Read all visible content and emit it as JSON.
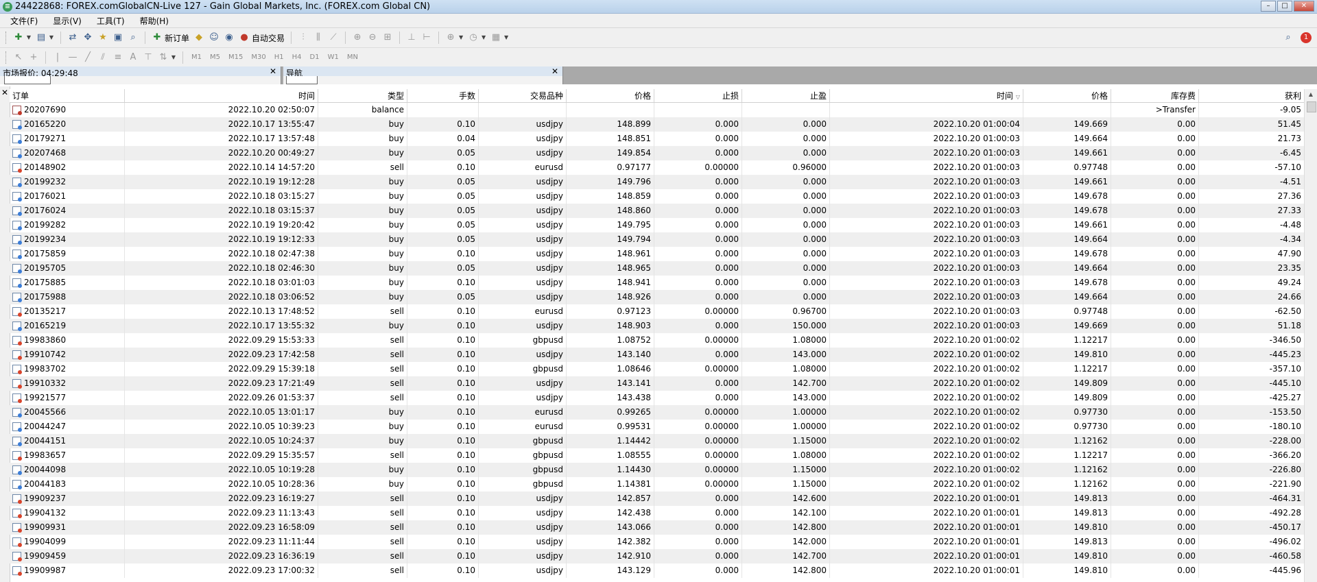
{
  "window": {
    "title": "24422868: FOREX.comGlobalCN-Live 127 - Gain Global Markets, Inc. (FOREX.com Global CN)",
    "app_icon": "mt4-app-icon"
  },
  "menu": [
    "文件(F)",
    "显示(V)",
    "工具(T)",
    "帮助(H)"
  ],
  "toolbar": {
    "new_order_label": "新订单",
    "auto_trade_label": "自动交易",
    "timeframes": [
      "M1",
      "M5",
      "M15",
      "M30",
      "H1",
      "H4",
      "D1",
      "W1",
      "MN"
    ],
    "notification_count": "1"
  },
  "panels": {
    "market_watch_title": "市场报价: 04:29:48",
    "navigator_title": "导航"
  },
  "columns": {
    "order": "订单",
    "open_time": "时间",
    "type": "类型",
    "lots": "手数",
    "symbol": "交易品种",
    "open_price": "价格",
    "sl": "止损",
    "tp": "止盈",
    "close_time": "时间",
    "close_price": "价格",
    "swap": "库存费",
    "profit": "获利"
  },
  "colors": {
    "buy_dot": "#3b7dd8",
    "sell_dot": "#d9442b",
    "balance_dot": "#c0392b"
  },
  "rows": [
    {
      "order": "20207690",
      "open_time": "2022.10.20 02:50:07",
      "type": "balance",
      "lots": "",
      "symbol": "",
      "open_price": "",
      "sl": "",
      "tp": "",
      "close_time": "",
      "close_price": "",
      "swap": ">Transfer",
      "profit": "-9.05"
    },
    {
      "order": "20165220",
      "open_time": "2022.10.17 13:55:47",
      "type": "buy",
      "lots": "0.10",
      "symbol": "usdjpy",
      "open_price": "148.899",
      "sl": "0.000",
      "tp": "0.000",
      "close_time": "2022.10.20 01:00:04",
      "close_price": "149.669",
      "swap": "0.00",
      "profit": "51.45"
    },
    {
      "order": "20179271",
      "open_time": "2022.10.17 13:57:48",
      "type": "buy",
      "lots": "0.04",
      "symbol": "usdjpy",
      "open_price": "148.851",
      "sl": "0.000",
      "tp": "0.000",
      "close_time": "2022.10.20 01:00:03",
      "close_price": "149.664",
      "swap": "0.00",
      "profit": "21.73"
    },
    {
      "order": "20207468",
      "open_time": "2022.10.20 00:49:27",
      "type": "buy",
      "lots": "0.05",
      "symbol": "usdjpy",
      "open_price": "149.854",
      "sl": "0.000",
      "tp": "0.000",
      "close_time": "2022.10.20 01:00:03",
      "close_price": "149.661",
      "swap": "0.00",
      "profit": "-6.45"
    },
    {
      "order": "20148902",
      "open_time": "2022.10.14 14:57:20",
      "type": "sell",
      "lots": "0.10",
      "symbol": "eurusd",
      "open_price": "0.97177",
      "sl": "0.00000",
      "tp": "0.96000",
      "close_time": "2022.10.20 01:00:03",
      "close_price": "0.97748",
      "swap": "0.00",
      "profit": "-57.10"
    },
    {
      "order": "20199232",
      "open_time": "2022.10.19 19:12:28",
      "type": "buy",
      "lots": "0.05",
      "symbol": "usdjpy",
      "open_price": "149.796",
      "sl": "0.000",
      "tp": "0.000",
      "close_time": "2022.10.20 01:00:03",
      "close_price": "149.661",
      "swap": "0.00",
      "profit": "-4.51"
    },
    {
      "order": "20176021",
      "open_time": "2022.10.18 03:15:27",
      "type": "buy",
      "lots": "0.05",
      "symbol": "usdjpy",
      "open_price": "148.859",
      "sl": "0.000",
      "tp": "0.000",
      "close_time": "2022.10.20 01:00:03",
      "close_price": "149.678",
      "swap": "0.00",
      "profit": "27.36"
    },
    {
      "order": "20176024",
      "open_time": "2022.10.18 03:15:37",
      "type": "buy",
      "lots": "0.05",
      "symbol": "usdjpy",
      "open_price": "148.860",
      "sl": "0.000",
      "tp": "0.000",
      "close_time": "2022.10.20 01:00:03",
      "close_price": "149.678",
      "swap": "0.00",
      "profit": "27.33"
    },
    {
      "order": "20199282",
      "open_time": "2022.10.19 19:20:42",
      "type": "buy",
      "lots": "0.05",
      "symbol": "usdjpy",
      "open_price": "149.795",
      "sl": "0.000",
      "tp": "0.000",
      "close_time": "2022.10.20 01:00:03",
      "close_price": "149.661",
      "swap": "0.00",
      "profit": "-4.48"
    },
    {
      "order": "20199234",
      "open_time": "2022.10.19 19:12:33",
      "type": "buy",
      "lots": "0.05",
      "symbol": "usdjpy",
      "open_price": "149.794",
      "sl": "0.000",
      "tp": "0.000",
      "close_time": "2022.10.20 01:00:03",
      "close_price": "149.664",
      "swap": "0.00",
      "profit": "-4.34"
    },
    {
      "order": "20175859",
      "open_time": "2022.10.18 02:47:38",
      "type": "buy",
      "lots": "0.10",
      "symbol": "usdjpy",
      "open_price": "148.961",
      "sl": "0.000",
      "tp": "0.000",
      "close_time": "2022.10.20 01:00:03",
      "close_price": "149.678",
      "swap": "0.00",
      "profit": "47.90"
    },
    {
      "order": "20195705",
      "open_time": "2022.10.18 02:46:30",
      "type": "buy",
      "lots": "0.05",
      "symbol": "usdjpy",
      "open_price": "148.965",
      "sl": "0.000",
      "tp": "0.000",
      "close_time": "2022.10.20 01:00:03",
      "close_price": "149.664",
      "swap": "0.00",
      "profit": "23.35"
    },
    {
      "order": "20175885",
      "open_time": "2022.10.18 03:01:03",
      "type": "buy",
      "lots": "0.10",
      "symbol": "usdjpy",
      "open_price": "148.941",
      "sl": "0.000",
      "tp": "0.000",
      "close_time": "2022.10.20 01:00:03",
      "close_price": "149.678",
      "swap": "0.00",
      "profit": "49.24"
    },
    {
      "order": "20175988",
      "open_time": "2022.10.18 03:06:52",
      "type": "buy",
      "lots": "0.05",
      "symbol": "usdjpy",
      "open_price": "148.926",
      "sl": "0.000",
      "tp": "0.000",
      "close_time": "2022.10.20 01:00:03",
      "close_price": "149.664",
      "swap": "0.00",
      "profit": "24.66"
    },
    {
      "order": "20135217",
      "open_time": "2022.10.13 17:48:52",
      "type": "sell",
      "lots": "0.10",
      "symbol": "eurusd",
      "open_price": "0.97123",
      "sl": "0.00000",
      "tp": "0.96700",
      "close_time": "2022.10.20 01:00:03",
      "close_price": "0.97748",
      "swap": "0.00",
      "profit": "-62.50"
    },
    {
      "order": "20165219",
      "open_time": "2022.10.17 13:55:32",
      "type": "buy",
      "lots": "0.10",
      "symbol": "usdjpy",
      "open_price": "148.903",
      "sl": "0.000",
      "tp": "150.000",
      "close_time": "2022.10.20 01:00:03",
      "close_price": "149.669",
      "swap": "0.00",
      "profit": "51.18"
    },
    {
      "order": "19983860",
      "open_time": "2022.09.29 15:53:33",
      "type": "sell",
      "lots": "0.10",
      "symbol": "gbpusd",
      "open_price": "1.08752",
      "sl": "0.00000",
      "tp": "1.08000",
      "close_time": "2022.10.20 01:00:02",
      "close_price": "1.12217",
      "swap": "0.00",
      "profit": "-346.50"
    },
    {
      "order": "19910742",
      "open_time": "2022.09.23 17:42:58",
      "type": "sell",
      "lots": "0.10",
      "symbol": "usdjpy",
      "open_price": "143.140",
      "sl": "0.000",
      "tp": "143.000",
      "close_time": "2022.10.20 01:00:02",
      "close_price": "149.810",
      "swap": "0.00",
      "profit": "-445.23"
    },
    {
      "order": "19983702",
      "open_time": "2022.09.29 15:39:18",
      "type": "sell",
      "lots": "0.10",
      "symbol": "gbpusd",
      "open_price": "1.08646",
      "sl": "0.00000",
      "tp": "1.08000",
      "close_time": "2022.10.20 01:00:02",
      "close_price": "1.12217",
      "swap": "0.00",
      "profit": "-357.10"
    },
    {
      "order": "19910332",
      "open_time": "2022.09.23 17:21:49",
      "type": "sell",
      "lots": "0.10",
      "symbol": "usdjpy",
      "open_price": "143.141",
      "sl": "0.000",
      "tp": "142.700",
      "close_time": "2022.10.20 01:00:02",
      "close_price": "149.809",
      "swap": "0.00",
      "profit": "-445.10"
    },
    {
      "order": "19921577",
      "open_time": "2022.09.26 01:53:37",
      "type": "sell",
      "lots": "0.10",
      "symbol": "usdjpy",
      "open_price": "143.438",
      "sl": "0.000",
      "tp": "143.000",
      "close_time": "2022.10.20 01:00:02",
      "close_price": "149.809",
      "swap": "0.00",
      "profit": "-425.27"
    },
    {
      "order": "20045566",
      "open_time": "2022.10.05 13:01:17",
      "type": "buy",
      "lots": "0.10",
      "symbol": "eurusd",
      "open_price": "0.99265",
      "sl": "0.00000",
      "tp": "1.00000",
      "close_time": "2022.10.20 01:00:02",
      "close_price": "0.97730",
      "swap": "0.00",
      "profit": "-153.50"
    },
    {
      "order": "20044247",
      "open_time": "2022.10.05 10:39:23",
      "type": "buy",
      "lots": "0.10",
      "symbol": "eurusd",
      "open_price": "0.99531",
      "sl": "0.00000",
      "tp": "1.00000",
      "close_time": "2022.10.20 01:00:02",
      "close_price": "0.97730",
      "swap": "0.00",
      "profit": "-180.10"
    },
    {
      "order": "20044151",
      "open_time": "2022.10.05 10:24:37",
      "type": "buy",
      "lots": "0.10",
      "symbol": "gbpusd",
      "open_price": "1.14442",
      "sl": "0.00000",
      "tp": "1.15000",
      "close_time": "2022.10.20 01:00:02",
      "close_price": "1.12162",
      "swap": "0.00",
      "profit": "-228.00"
    },
    {
      "order": "19983657",
      "open_time": "2022.09.29 15:35:57",
      "type": "sell",
      "lots": "0.10",
      "symbol": "gbpusd",
      "open_price": "1.08555",
      "sl": "0.00000",
      "tp": "1.08000",
      "close_time": "2022.10.20 01:00:02",
      "close_price": "1.12217",
      "swap": "0.00",
      "profit": "-366.20"
    },
    {
      "order": "20044098",
      "open_time": "2022.10.05 10:19:28",
      "type": "buy",
      "lots": "0.10",
      "symbol": "gbpusd",
      "open_price": "1.14430",
      "sl": "0.00000",
      "tp": "1.15000",
      "close_time": "2022.10.20 01:00:02",
      "close_price": "1.12162",
      "swap": "0.00",
      "profit": "-226.80"
    },
    {
      "order": "20044183",
      "open_time": "2022.10.05 10:28:36",
      "type": "buy",
      "lots": "0.10",
      "symbol": "gbpusd",
      "open_price": "1.14381",
      "sl": "0.00000",
      "tp": "1.15000",
      "close_time": "2022.10.20 01:00:02",
      "close_price": "1.12162",
      "swap": "0.00",
      "profit": "-221.90"
    },
    {
      "order": "19909237",
      "open_time": "2022.09.23 16:19:27",
      "type": "sell",
      "lots": "0.10",
      "symbol": "usdjpy",
      "open_price": "142.857",
      "sl": "0.000",
      "tp": "142.600",
      "close_time": "2022.10.20 01:00:01",
      "close_price": "149.813",
      "swap": "0.00",
      "profit": "-464.31"
    },
    {
      "order": "19904132",
      "open_time": "2022.09.23 11:13:43",
      "type": "sell",
      "lots": "0.10",
      "symbol": "usdjpy",
      "open_price": "142.438",
      "sl": "0.000",
      "tp": "142.100",
      "close_time": "2022.10.20 01:00:01",
      "close_price": "149.813",
      "swap": "0.00",
      "profit": "-492.28"
    },
    {
      "order": "19909931",
      "open_time": "2022.09.23 16:58:09",
      "type": "sell",
      "lots": "0.10",
      "symbol": "usdjpy",
      "open_price": "143.066",
      "sl": "0.000",
      "tp": "142.800",
      "close_time": "2022.10.20 01:00:01",
      "close_price": "149.810",
      "swap": "0.00",
      "profit": "-450.17"
    },
    {
      "order": "19904099",
      "open_time": "2022.09.23 11:11:44",
      "type": "sell",
      "lots": "0.10",
      "symbol": "usdjpy",
      "open_price": "142.382",
      "sl": "0.000",
      "tp": "142.000",
      "close_time": "2022.10.20 01:00:01",
      "close_price": "149.813",
      "swap": "0.00",
      "profit": "-496.02"
    },
    {
      "order": "19909459",
      "open_time": "2022.09.23 16:36:19",
      "type": "sell",
      "lots": "0.10",
      "symbol": "usdjpy",
      "open_price": "142.910",
      "sl": "0.000",
      "tp": "142.700",
      "close_time": "2022.10.20 01:00:01",
      "close_price": "149.810",
      "swap": "0.00",
      "profit": "-460.58"
    },
    {
      "order": "19909987",
      "open_time": "2022.09.23 17:00:32",
      "type": "sell",
      "lots": "0.10",
      "symbol": "usdjpy",
      "open_price": "143.129",
      "sl": "0.000",
      "tp": "142.800",
      "close_time": "2022.10.20 01:00:01",
      "close_price": "149.810",
      "swap": "0.00",
      "profit": "-445.96"
    }
  ]
}
